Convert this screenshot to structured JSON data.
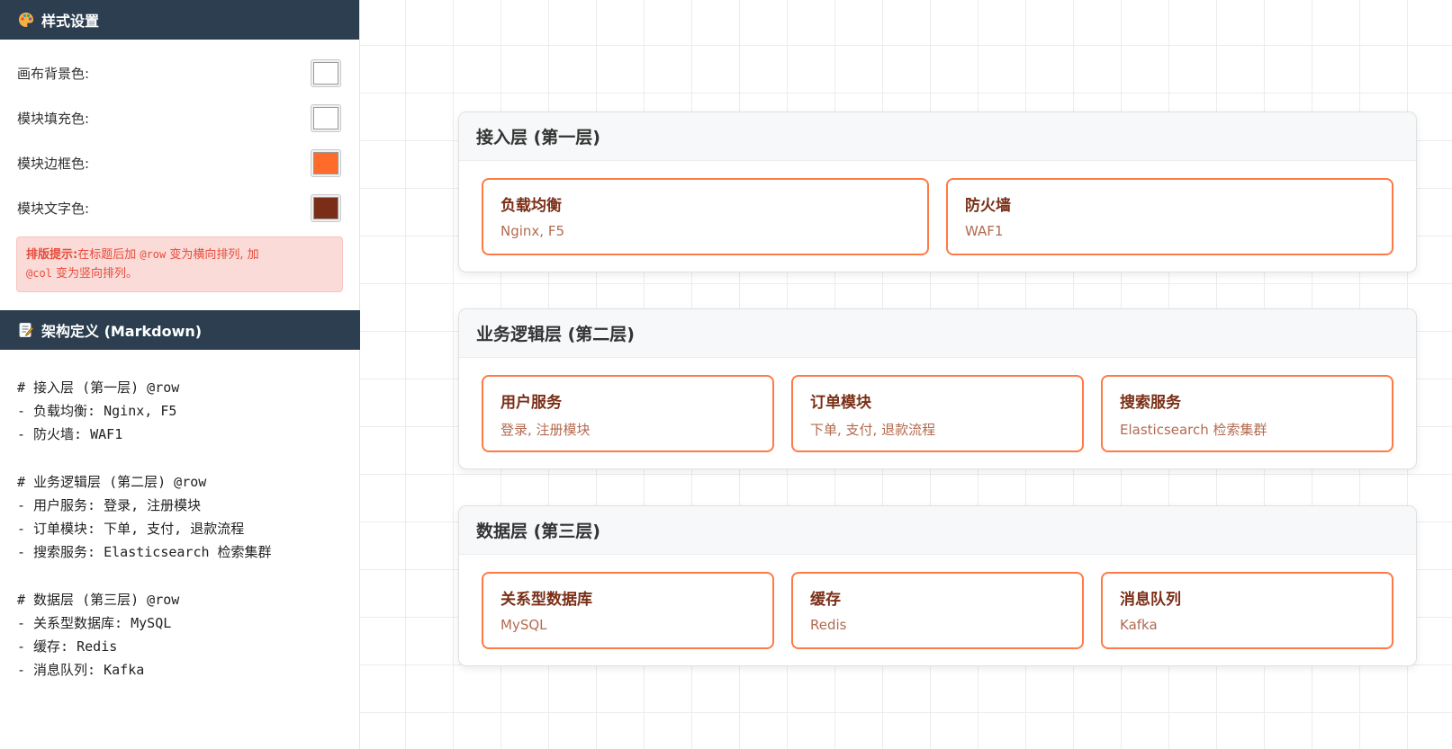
{
  "style_panel": {
    "title": "样式设置",
    "icon": "palette-icon",
    "settings": [
      {
        "label": "画布背景色:",
        "color": "#ffffff"
      },
      {
        "label": "模块填充色:",
        "color": "#ffffff"
      },
      {
        "label": "模块边框色:",
        "color": "#ff6b2b"
      },
      {
        "label": "模块文字色:",
        "color": "#7a2d17"
      }
    ],
    "hint": {
      "strong": "排版提示:",
      "text1": "在标题后加 ",
      "code_row": "@row",
      "text2": " 变为横向排列, 加",
      "code_col": "@col",
      "text3": " 变为竖向排列。"
    }
  },
  "markdown_panel": {
    "title": "架构定义 (Markdown)",
    "icon": "memo-icon",
    "content": "# 接入层 (第一层) @row\n- 负载均衡: Nginx, F5\n- 防火墙: WAF1\n\n# 业务逻辑层 (第二层) @row\n- 用户服务: 登录, 注册模块\n- 订单模块: 下单, 支付, 退款流程\n- 搜索服务: Elasticsearch 检索集群\n\n# 数据层 (第三层) @row\n- 关系型数据库: MySQL\n- 缓存: Redis\n- 消息队列: Kafka"
  },
  "layers": [
    {
      "title": "接入层 (第一层)",
      "modules": [
        {
          "name": "负载均衡",
          "desc": "Nginx, F5"
        },
        {
          "name": "防火墙",
          "desc": "WAF1"
        }
      ]
    },
    {
      "title": "业务逻辑层 (第二层)",
      "modules": [
        {
          "name": "用户服务",
          "desc": "登录, 注册模块"
        },
        {
          "name": "订单模块",
          "desc": "下单, 支付, 退款流程"
        },
        {
          "name": "搜索服务",
          "desc": "Elasticsearch 检索集群"
        }
      ]
    },
    {
      "title": "数据层 (第三层)",
      "modules": [
        {
          "name": "关系型数据库",
          "desc": "MySQL"
        },
        {
          "name": "缓存",
          "desc": "Redis"
        },
        {
          "name": "消息队列",
          "desc": "Kafka"
        }
      ]
    }
  ]
}
